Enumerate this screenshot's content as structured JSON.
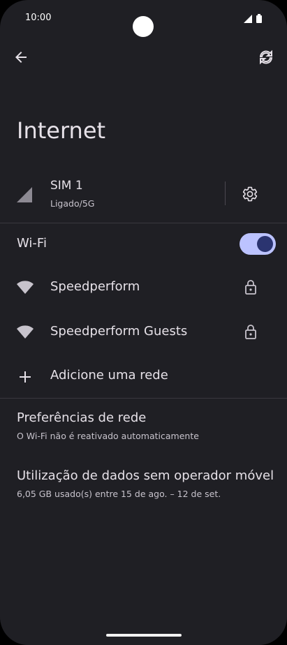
{
  "status_bar": {
    "time": "10:00",
    "icons": [
      "signal-icon",
      "battery-icon"
    ]
  },
  "top_bar": {
    "back_icon": "arrow-left-icon",
    "action_icon": "refresh-icon"
  },
  "page": {
    "title": "Internet"
  },
  "sim": {
    "name": "SIM 1",
    "status": "Ligado/5G",
    "icon": "cell-signal-icon",
    "settings_icon": "gear-icon"
  },
  "wifi": {
    "label": "Wi-Fi",
    "enabled": true,
    "toggle_color": "#bcc3ff"
  },
  "networks": [
    {
      "name": "Speedperform",
      "secured": true
    },
    {
      "name": "Speedperform Guests",
      "secured": true
    }
  ],
  "add_network": {
    "label": "Adicione uma rede"
  },
  "preferences": {
    "title": "Preferências de rede",
    "subtitle": "O Wi-Fi não é reativado automaticamente"
  },
  "data_usage": {
    "title": "Utilização de dados sem operador móvel",
    "subtitle": "6,05 GB usado(s) entre 15 de ago. – 12 de set."
  },
  "colors": {
    "background": "#1f1f24",
    "text": "#e6e1e8",
    "accent": "#bcc3ff"
  }
}
